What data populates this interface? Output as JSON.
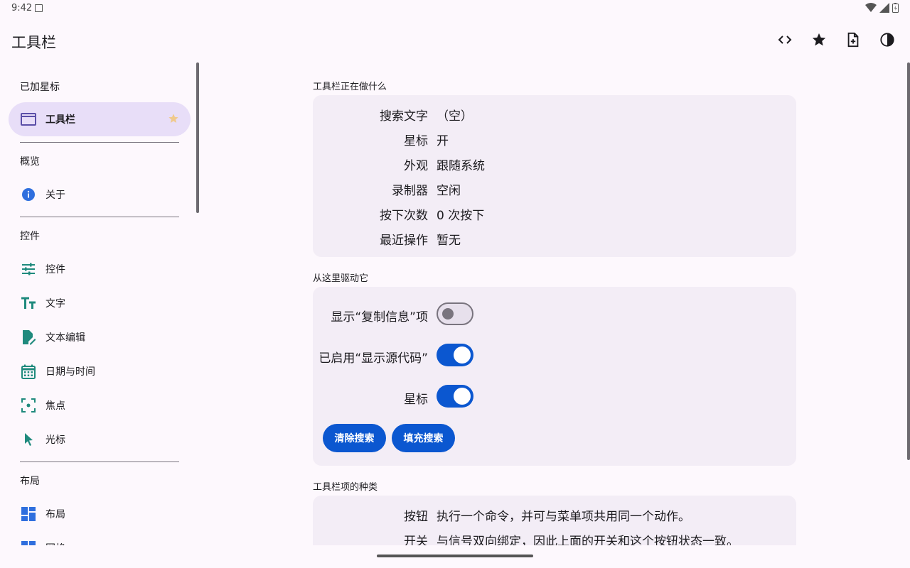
{
  "status": {
    "time": "9:42"
  },
  "appbar": {
    "title": "工具栏",
    "actions": [
      "code-icon",
      "star-icon",
      "note-add-icon",
      "contrast-icon"
    ]
  },
  "sidebar": {
    "sections": [
      {
        "title": "已加星标",
        "items": [
          {
            "label": "工具栏",
            "icon": "window-icon",
            "active": true
          }
        ]
      },
      {
        "title": "概览",
        "items": [
          {
            "label": "关于",
            "icon": "info-icon"
          }
        ]
      },
      {
        "title": "控件",
        "items": [
          {
            "label": "控件",
            "icon": "tune-icon"
          },
          {
            "label": "文字",
            "icon": "text-fields-icon"
          },
          {
            "label": "文本编辑",
            "icon": "edit-note-icon"
          },
          {
            "label": "日期与时间",
            "icon": "calendar-icon"
          },
          {
            "label": "焦点",
            "icon": "focus-icon"
          },
          {
            "label": "光标",
            "icon": "cursor-icon"
          }
        ]
      },
      {
        "title": "布局",
        "items": [
          {
            "label": "布局",
            "icon": "dashboard-icon"
          },
          {
            "label": "网格",
            "icon": "grid-icon"
          }
        ]
      }
    ]
  },
  "main": {
    "status_group": {
      "title": "工具栏正在做什么",
      "rows": [
        {
          "key": "搜索文字",
          "value": "（空）"
        },
        {
          "key": "星标",
          "value": "开"
        },
        {
          "key": "外观",
          "value": "跟随系统"
        },
        {
          "key": "录制器",
          "value": "空闲"
        },
        {
          "key": "按下次数",
          "value": "0 次按下"
        },
        {
          "key": "最近操作",
          "value": "暂无"
        }
      ]
    },
    "drive_group": {
      "title": "从这里驱动它",
      "toggles": [
        {
          "label": "显示“复制信息”项",
          "on": false
        },
        {
          "label": "已启用“显示源代码”",
          "on": true
        },
        {
          "label": "星标",
          "on": true
        }
      ],
      "buttons": [
        "清除搜索",
        "填充搜索"
      ]
    },
    "kinds_group": {
      "title": "工具栏项的种类",
      "rows": [
        {
          "key": "按钮",
          "value": "执行一个命令，并可与菜单项共用同一个动作。"
        },
        {
          "key": "开关",
          "value": "与信号双向绑定，因此上面的开关和这个按钮状态一致。"
        }
      ]
    }
  },
  "colors": {
    "accent": "#0b57d0",
    "active_nav": "#e8def8",
    "card": "#f3edf6",
    "icon_teal": "#1f8a7d"
  }
}
